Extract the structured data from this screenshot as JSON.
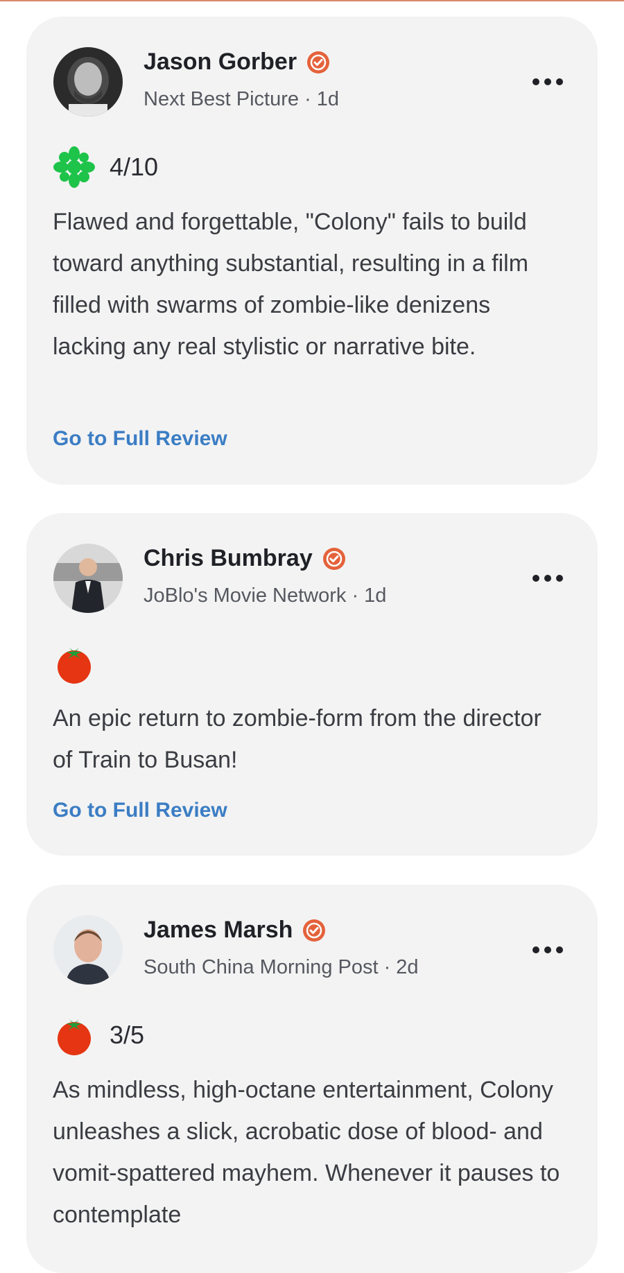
{
  "colors": {
    "card_bg": "#f3f3f3",
    "verified": "#e4623b",
    "link": "#3b7dc4",
    "rotten_green": "#1ec34a",
    "fresh_red": "#e53512"
  },
  "reviews": [
    {
      "critic": "Jason Gorber",
      "outlet_line": "Next Best Picture · 1d",
      "score_icon": "rotten-splat-icon",
      "score": "4/10",
      "quote": "Flawed and forgettable, \"Colony\" fails to build toward anything substantial, resulting in a film filled with swarms of zombie-like denizens lacking any real stylistic or narrative bite.",
      "link_label": "Go to Full Review"
    },
    {
      "critic": "Chris Bumbray",
      "outlet_line": "JoBlo's Movie Network · 1d",
      "score_icon": "fresh-tomato-icon",
      "score": "",
      "quote": "An epic return to zombie-form from the director of Train to Busan!",
      "link_label": "Go to Full Review"
    },
    {
      "critic": "James Marsh",
      "outlet_line": "South China Morning Post · 2d",
      "score_icon": "fresh-tomato-icon",
      "score": "3/5",
      "quote": "As mindless, high-octane entertainment, Colony unleashes a slick, acrobatic dose of blood- and vomit-spattered mayhem. Whenever it pauses to contemplate",
      "link_label": ""
    }
  ]
}
